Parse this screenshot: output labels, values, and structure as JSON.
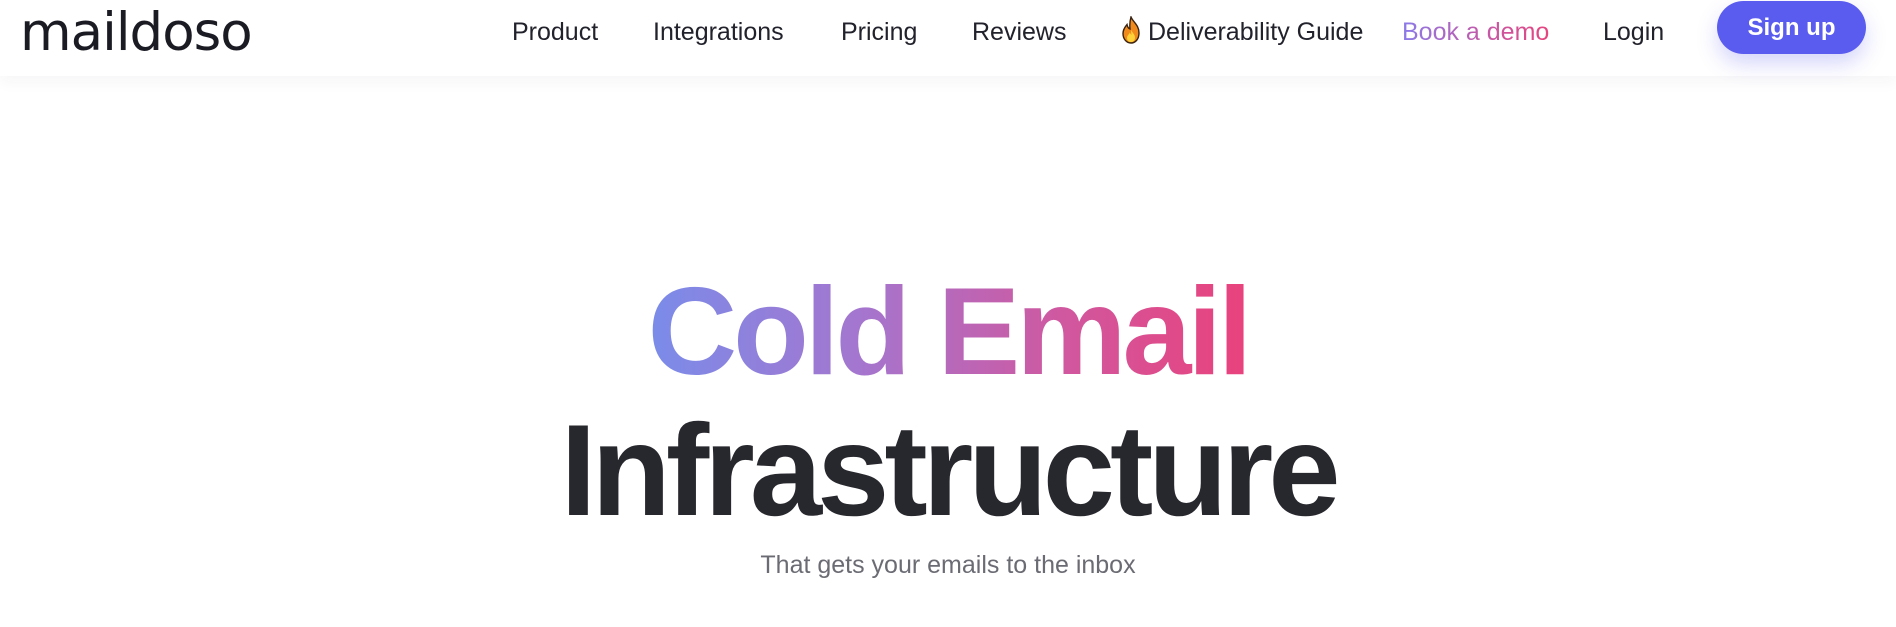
{
  "header": {
    "logo_text": "maildoso",
    "nav": {
      "product": "Product",
      "integrations": "Integrations",
      "pricing": "Pricing",
      "reviews": "Reviews",
      "guide_icon": "fire-icon",
      "guide": "Deliverability Guide",
      "demo": "Book a demo",
      "login": "Login"
    },
    "signup_label": "Sign up"
  },
  "hero": {
    "title_highlight": "Cold Email",
    "title_main": "Infrastructure",
    "subtitle": "That gets your emails to the inbox"
  },
  "colors": {
    "accent": "#5a5cf0",
    "gradient_start": "#7a8ce9",
    "gradient_end": "#e9427c",
    "headline": "#27272e"
  }
}
